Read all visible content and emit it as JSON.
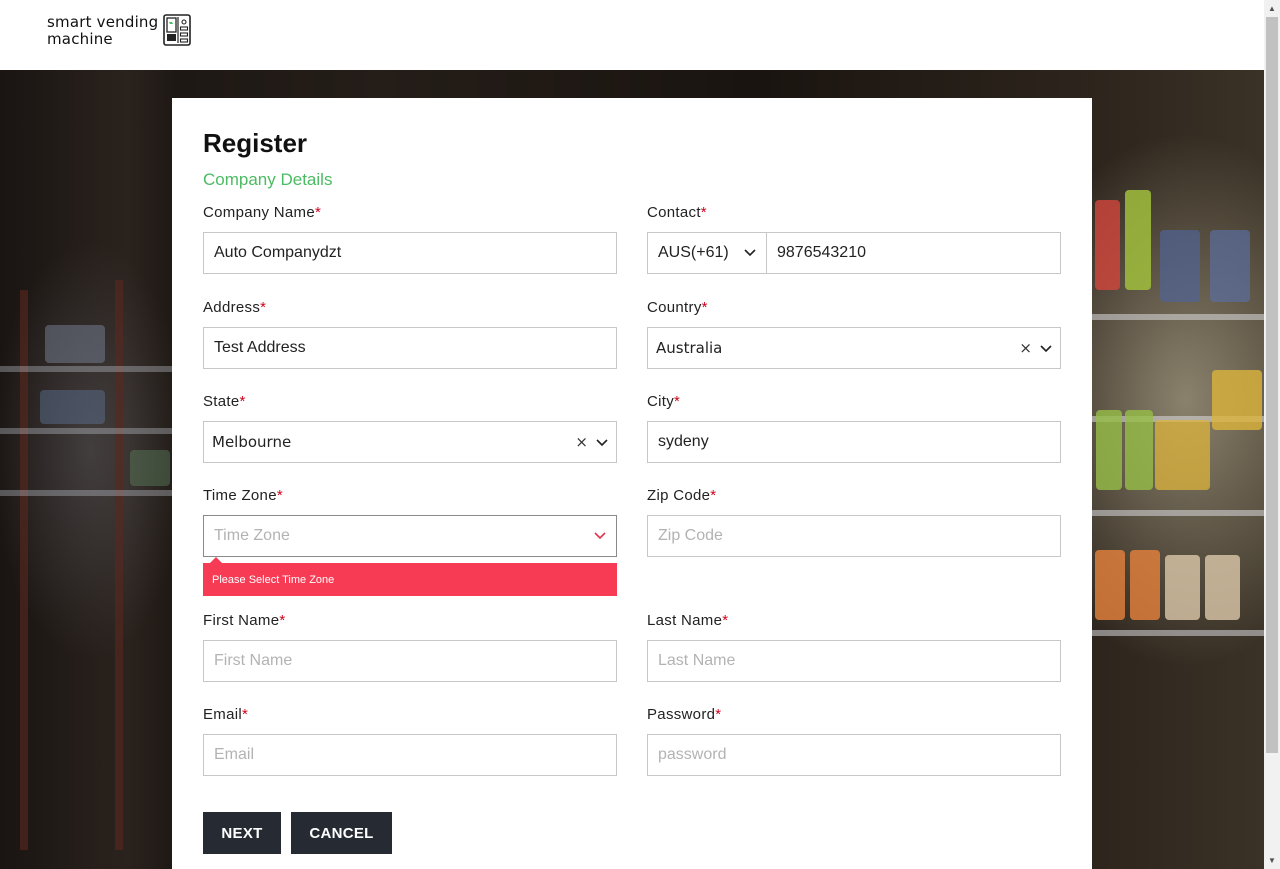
{
  "brand": {
    "line1": "smart vending",
    "line2": "machine"
  },
  "form": {
    "title": "Register",
    "subtitle": "Company Details",
    "company_name": {
      "label": "Company Name",
      "value": "Auto Companydzt"
    },
    "contact": {
      "label": "Contact",
      "code": "AUS(+61)",
      "phone": "9876543210"
    },
    "address": {
      "label": "Address",
      "value": "Test Address"
    },
    "country": {
      "label": "Country",
      "value": "Australia",
      "clear": "×"
    },
    "state": {
      "label": "State",
      "value": "Melbourne",
      "clear": "×"
    },
    "city": {
      "label": "City",
      "value": "sydeny"
    },
    "time_zone": {
      "label": "Time Zone",
      "placeholder": "Time Zone",
      "error": "Please Select Time Zone"
    },
    "zip_code": {
      "label": "Zip Code",
      "placeholder": "Zip Code"
    },
    "first_name": {
      "label": "First Name",
      "placeholder": "First Name"
    },
    "last_name": {
      "label": "Last Name",
      "placeholder": "Last Name"
    },
    "email": {
      "label": "Email",
      "placeholder": "Email"
    },
    "password": {
      "label": "Password",
      "placeholder": "password"
    },
    "required_mark": "*",
    "next_label": "NEXT",
    "cancel_label": "CANCEL"
  },
  "colors": {
    "accent": "#4cbb63",
    "error": "#f73b54",
    "button": "#262b33",
    "required": "#d0021b"
  }
}
